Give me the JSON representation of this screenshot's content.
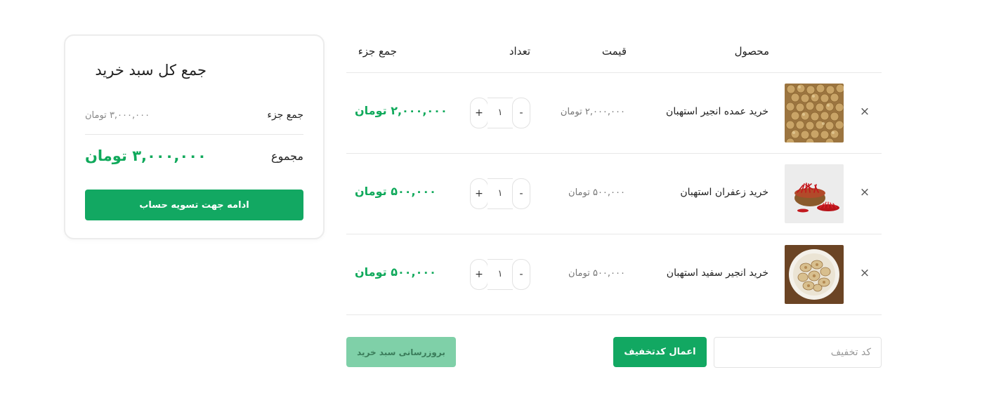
{
  "summary": {
    "title": "جمع کل سبد خرید",
    "subtotal_label": "جمع جزء",
    "subtotal_value": "۳,۰۰۰,۰۰۰ تومان",
    "total_label": "مجموع",
    "total_value": "۳,۰۰۰,۰۰۰ تومان",
    "checkout_label": "ادامه جهت تسویه حساب"
  },
  "table": {
    "headers": {
      "product": "محصول",
      "price": "قیمت",
      "quantity": "تعداد",
      "subtotal": "جمع جزء"
    },
    "rows": [
      {
        "remove_glyph": "×",
        "name": "خرید عمده انجیر استهبان",
        "price": "۲,۰۰۰,۰۰۰ تومان",
        "qty": "۱",
        "minus": "-",
        "plus": "+",
        "row_total": "۲,۰۰۰,۰۰۰ تومان",
        "image": "dried-figs-icon"
      },
      {
        "remove_glyph": "×",
        "name": "خرید زعفران استهبان",
        "price": "۵۰۰,۰۰۰ تومان",
        "qty": "۱",
        "minus": "-",
        "plus": "+",
        "row_total": "۵۰۰,۰۰۰ تومان",
        "image": "saffron-icon"
      },
      {
        "remove_glyph": "×",
        "name": "خرید انجیر سفید استهبان",
        "price": "۵۰۰,۰۰۰ تومان",
        "qty": "۱",
        "minus": "-",
        "plus": "+",
        "row_total": "۵۰۰,۰۰۰ تومان",
        "image": "white-figs-bowl-icon"
      }
    ]
  },
  "coupon": {
    "placeholder": "کد تخفیف",
    "apply_label": "اعمال کدتخفیف"
  },
  "update_cart_label": "بروزرسانی سبد خرید",
  "colors": {
    "accent": "#12a862",
    "price_green": "#10a95b",
    "update_button": "#7fd0a8"
  }
}
